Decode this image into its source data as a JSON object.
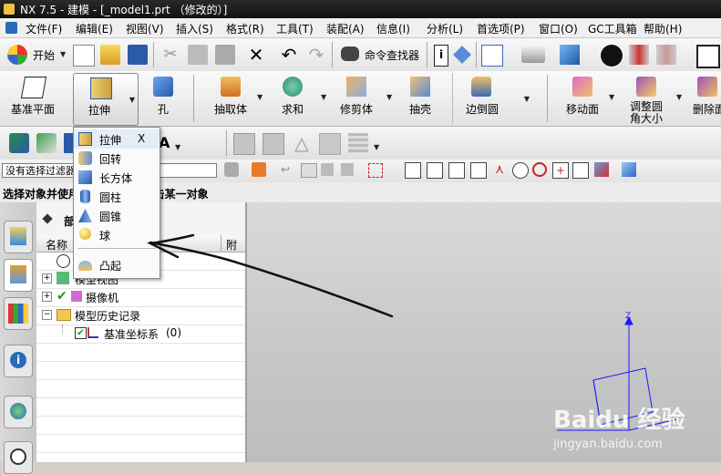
{
  "window": {
    "title": "NX 7.5 - 建模 - [_model1.prt （修改的）]"
  },
  "menubar": {
    "items": [
      "文件(F)",
      "编辑(E)",
      "视图(V)",
      "插入(S)",
      "格式(R)",
      "工具(T)",
      "装配(A)",
      "信息(I)",
      "分析(L)",
      "首选项(P)",
      "窗口(O)",
      "GC工具箱",
      "帮助(H)"
    ]
  },
  "toolbar": {
    "start_label": "开始",
    "command_finder": "命令查找器"
  },
  "feature_toolbar": {
    "buttons": [
      "基准平面",
      "拉伸",
      "孔",
      "抽取体",
      "求和",
      "修剪体",
      "抽壳",
      "边倒圆",
      "移动面",
      "调整圆角大小",
      "删除面"
    ]
  },
  "selection": {
    "filter_placeholder": "没有选择过滤器",
    "status": "选择对象并使用 MB3，或者双击某一对象"
  },
  "extrude_dropdown": {
    "items": [
      {
        "label": "拉伸",
        "shortcut": "X",
        "icon": "extrude-icon"
      },
      {
        "label": "回转",
        "icon": "revolve-icon"
      },
      {
        "label": "长方体",
        "icon": "block-icon"
      },
      {
        "label": "圆柱",
        "icon": "cylinder-icon"
      },
      {
        "label": "圆锥",
        "icon": "cone-icon"
      },
      {
        "label": "球",
        "icon": "sphere-icon"
      },
      {
        "label": "凸起",
        "icon": "emboss-icon"
      }
    ]
  },
  "navigator": {
    "title": "部",
    "col_name": "名称",
    "col_extra": "附",
    "rows": [
      {
        "label": "模型视图"
      },
      {
        "label": "摄像机"
      },
      {
        "label": "模型历史记录"
      },
      {
        "label": "基准坐标系",
        "suffix": "(0)"
      }
    ]
  },
  "viewport": {
    "axis_label": "Z"
  },
  "watermark": {
    "text": "Baidu 经验",
    "url": "jingyan.baidu.com"
  },
  "colors": {
    "titlebar": "#1a1a1a",
    "selection_blue": "#1a1aff",
    "viewport_bg": "#c8c8c8"
  }
}
